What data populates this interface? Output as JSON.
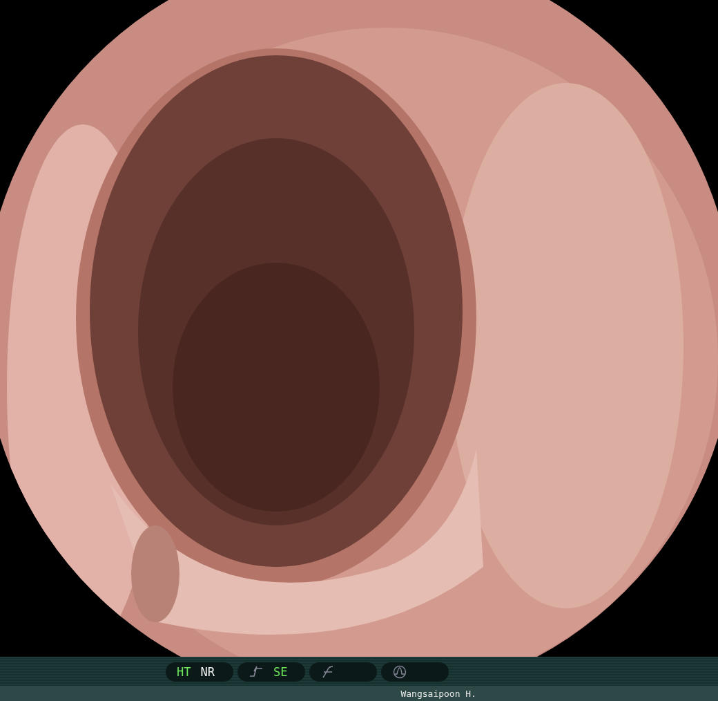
{
  "status_bar": {
    "groups": [
      {
        "kind": "modes",
        "items": [
          {
            "text": "HT",
            "lit": true
          },
          {
            "text": "NR",
            "lit": false
          }
        ]
      },
      {
        "kind": "curve",
        "items": [
          {
            "text": "SE",
            "lit": true
          }
        ]
      },
      {
        "kind": "slash"
      },
      {
        "kind": "wave"
      }
    ]
  },
  "operator": "Wangsaipoon H."
}
